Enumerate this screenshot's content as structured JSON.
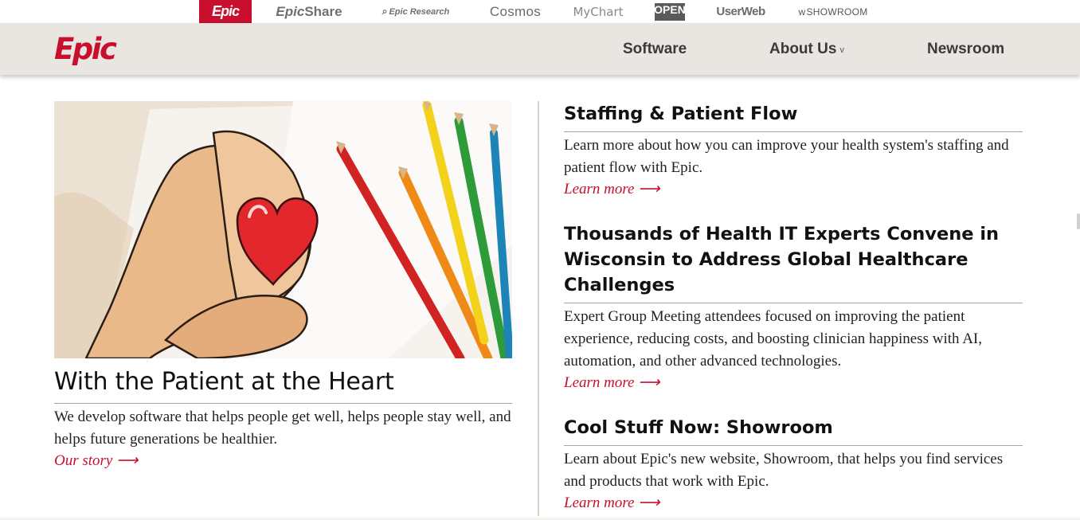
{
  "brand_strip": {
    "epic": "Epic",
    "epicshare_main": "Epic",
    "epicshare_sub": "Share",
    "epic_research": "Epic Research",
    "cosmos": "Cosmos",
    "mychart": "MyChart",
    "open_epic": "OPEN",
    "userweb": "UserWeb",
    "showroom": "SHOWROOM"
  },
  "nav": {
    "logo": "Epic",
    "items": [
      {
        "label": "Software"
      },
      {
        "label": "About Us"
      },
      {
        "label": "Newsroom"
      }
    ]
  },
  "feature": {
    "title": "With the Patient at the Heart",
    "description": "We develop software that helps people get well, helps people stay well, and helps future generations be healthier.",
    "link": "Our story ⟶"
  },
  "articles": [
    {
      "title": "Staffing & Patient Flow",
      "description": "Learn more about how you can improve your health system's staffing and patient flow with Epic.",
      "link": "Learn more ⟶"
    },
    {
      "title": "Thousands of Health IT Experts Convene in Wisconsin to Address Global Healthcare Challenges",
      "description": "Expert Group Meeting attendees focused on improving the patient experience, reducing costs, and boosting clinician happiness with AI, automation, and other advanced technologies.",
      "link": "Learn more ⟶"
    },
    {
      "title": "Cool Stuff Now: Showroom",
      "description": "Learn about Epic's new website, Showroom, that helps you find services and products that work with Epic.",
      "link": "Learn more ⟶"
    }
  ],
  "colors": {
    "brand_red": "#c8102e",
    "nav_bg": "#e9e6e1",
    "divider": "#a6a6a6"
  }
}
